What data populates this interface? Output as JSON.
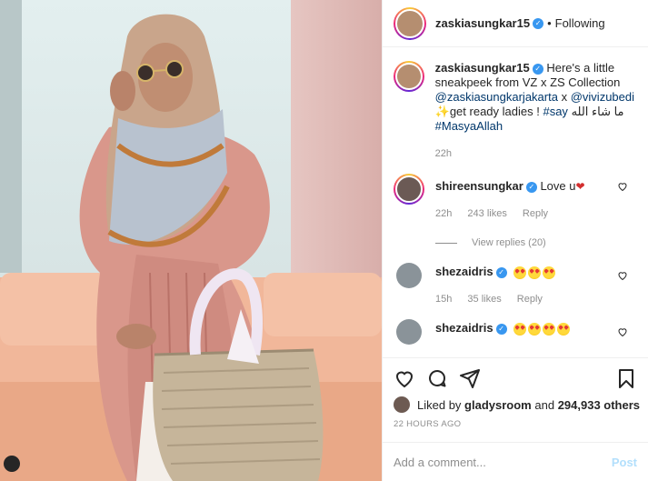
{
  "post": {
    "username": "zaskiasungkar15",
    "follow_separator": "•",
    "follow_state": "Following",
    "caption_parts": {
      "intro": "Here's a little sneakpeek from VZ x ZS Collection",
      "mention1": "@zaskiasungkarjakarta",
      "x": "x",
      "mention2": "@vivizubedi",
      "rest": "get ready ladies !",
      "tag1": "#say",
      "arabic": "ما شاء الله",
      "tag2": "#MasyaAllah"
    },
    "caption_time": "22h"
  },
  "comments": [
    {
      "username": "shireensungkar",
      "text": "Love u",
      "time": "22h",
      "likes": "243 likes",
      "reply": "Reply"
    },
    {
      "username": "shezaidris",
      "text": "",
      "time": "15h",
      "likes": "35 likes",
      "reply": "Reply"
    },
    {
      "username": "shezaidris",
      "text": "",
      "time": "",
      "likes": "",
      "reply": ""
    }
  ],
  "view_replies": "View replies (20)",
  "likes": {
    "prefix": "Liked by",
    "user": "gladysroom",
    "and": "and",
    "others": "294,933 others"
  },
  "timestamp": "22 HOURS AGO",
  "add_comment": {
    "placeholder": "Add a comment...",
    "post_label": "Post"
  },
  "icons": [
    "heart-icon",
    "comment-icon",
    "share-icon",
    "bookmark-icon",
    "verified-icon"
  ],
  "colors": {
    "link": "#00376b",
    "verified": "#3897f0",
    "muted": "#8e8e8e",
    "post_disabled": "#b2dffc"
  }
}
